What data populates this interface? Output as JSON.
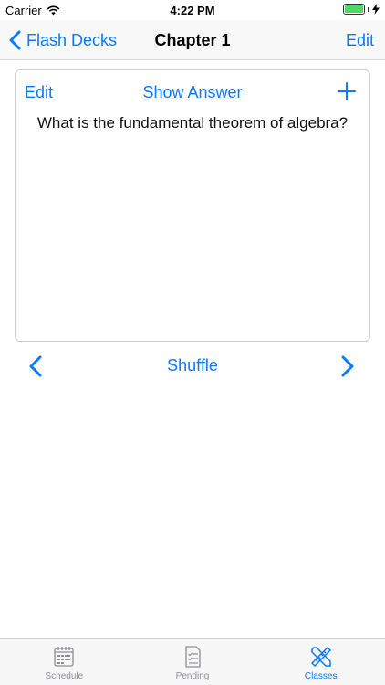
{
  "status": {
    "carrier": "Carrier",
    "time": "4:22 PM"
  },
  "nav": {
    "back_label": "Flash Decks",
    "title": "Chapter 1",
    "edit_label": "Edit"
  },
  "card": {
    "edit_label": "Edit",
    "show_answer_label": "Show Answer",
    "question": "What is the fundamental theorem of algebra?"
  },
  "controls": {
    "shuffle_label": "Shuffle"
  },
  "tabs": [
    {
      "label": "Schedule",
      "icon": "calendar-icon",
      "active": false
    },
    {
      "label": "Pending",
      "icon": "checklist-icon",
      "active": false
    },
    {
      "label": "Classes",
      "icon": "pencil-ruler-icon",
      "active": true
    }
  ],
  "colors": {
    "accent": "#0a7aff",
    "inactive": "#8e8e93"
  }
}
